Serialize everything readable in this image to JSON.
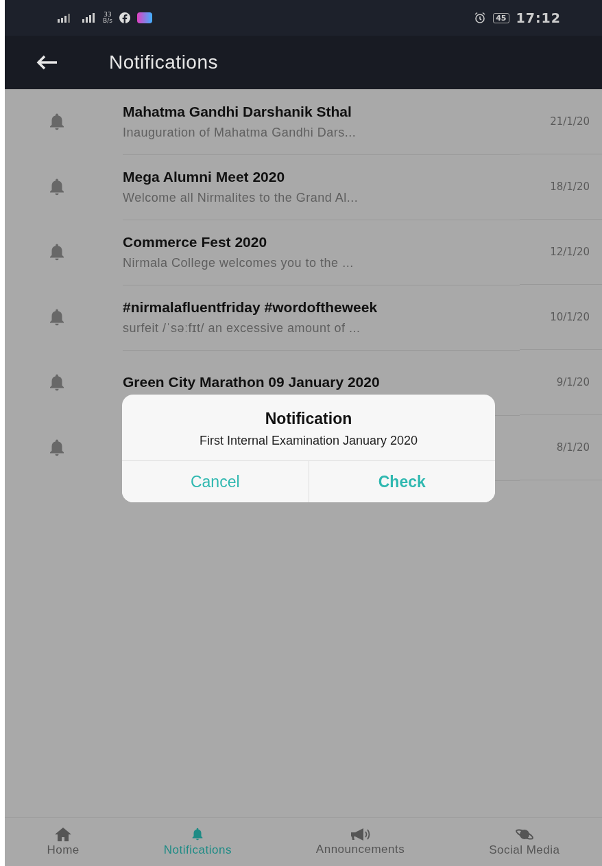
{
  "status_bar": {
    "speed_value": "33",
    "speed_unit": "B/s",
    "battery": "45",
    "time": "17:12"
  },
  "app_bar": {
    "title": "Notifications"
  },
  "notifications": [
    {
      "title": "Mahatma Gandhi Darshanik Sthal",
      "preview": "Inauguration of Mahatma Gandhi Dars...",
      "date": "21/1/20"
    },
    {
      "title": "Mega Alumni Meet 2020",
      "preview": "Welcome all Nirmalites to the Grand Al...",
      "date": "18/1/20"
    },
    {
      "title": "Commerce Fest 2020",
      "preview": "Nirmala College welcomes you to the ...",
      "date": "12/1/20"
    },
    {
      "title": "#nirmalafluentfriday #wordoftheweek",
      "preview": "surfeit /ˈsəːfɪt/ an excessive amount of ...",
      "date": "10/1/20"
    },
    {
      "title": "Green City Marathon 09 January 2020",
      "date": "9/1/20"
    },
    {
      "date": "8/1/20"
    }
  ],
  "dialog": {
    "title": "Notification",
    "message": "First Internal Examination January 2020",
    "buttons": [
      "Cancel",
      "Check"
    ]
  },
  "bottom_nav": [
    {
      "kind": "home",
      "label": "Home",
      "selected": false
    },
    {
      "kind": "bell",
      "label": "Notifications",
      "selected": true
    },
    {
      "kind": "megaphone",
      "label": "Announcements",
      "selected": false
    },
    {
      "kind": "planet",
      "label": "Social Media",
      "selected": false
    }
  ]
}
